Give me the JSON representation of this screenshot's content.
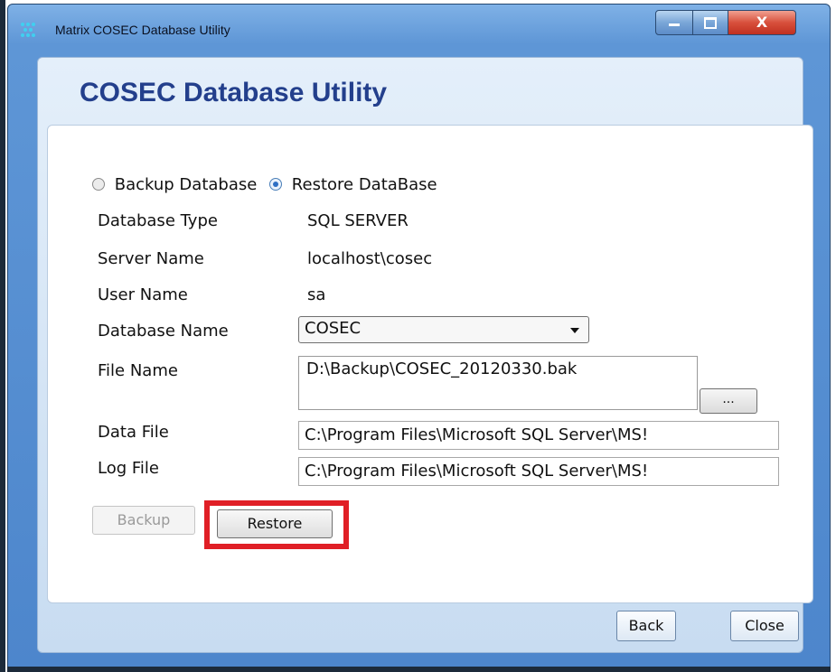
{
  "window": {
    "title": "Matrix COSEC Database Utility",
    "minimize_label": "",
    "maximize_label": "",
    "close_label": "X"
  },
  "app": {
    "heading": "COSEC Database Utility"
  },
  "mode": {
    "options": [
      "Backup Database",
      "Restore DataBase"
    ],
    "selected": "Restore DataBase"
  },
  "fields": {
    "database_type": {
      "label": "Database Type",
      "value": "SQL SERVER"
    },
    "server_name": {
      "label": "Server Name",
      "value": "localhost\\cosec"
    },
    "user_name": {
      "label": "User Name",
      "value": "sa"
    },
    "database_name": {
      "label": "Database Name",
      "value": "COSEC"
    },
    "file_name": {
      "label": "File Name",
      "value": "D:\\Backup\\COSEC_20120330.bak",
      "browse_label": "..."
    },
    "data_file": {
      "label": "Data File",
      "value": "C:\\Program Files\\Microsoft SQL Server\\MS!"
    },
    "log_file": {
      "label": "Log File",
      "value": "C:\\Program Files\\Microsoft SQL Server\\MS!"
    }
  },
  "actions": {
    "backup_label": "Backup",
    "restore_label": "Restore"
  },
  "footer": {
    "back_label": "Back",
    "close_label": "Close"
  },
  "colors": {
    "heading": "#233f8c",
    "highlight": "#e01f26",
    "window_frame": "#4d86cc"
  }
}
